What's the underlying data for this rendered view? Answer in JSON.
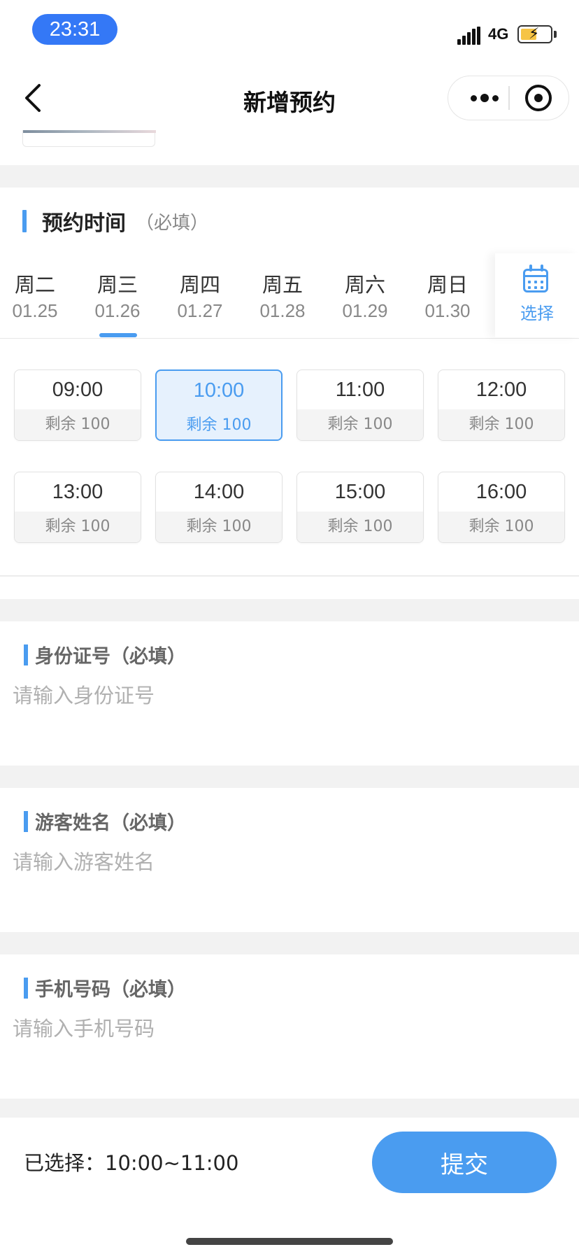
{
  "status_bar": {
    "time": "23:31",
    "network": "4G"
  },
  "nav": {
    "title": "新增预约"
  },
  "time_section": {
    "title": "预约时间",
    "required": "（必填）"
  },
  "days": [
    {
      "name": "周二",
      "date": "01.25"
    },
    {
      "name": "周三",
      "date": "01.26"
    },
    {
      "name": "周四",
      "date": "01.27"
    },
    {
      "name": "周五",
      "date": "01.28"
    },
    {
      "name": "周六",
      "date": "01.29"
    },
    {
      "name": "周日",
      "date": "01.30"
    }
  ],
  "selected_day_index": 1,
  "choose_label": "选择",
  "slots": [
    {
      "time": "09:00",
      "remaining": "剩余 100"
    },
    {
      "time": "10:00",
      "remaining": "剩余 100"
    },
    {
      "time": "11:00",
      "remaining": "剩余 100"
    },
    {
      "time": "12:00",
      "remaining": "剩余 100"
    },
    {
      "time": "13:00",
      "remaining": "剩余 100"
    },
    {
      "time": "14:00",
      "remaining": "剩余 100"
    },
    {
      "time": "15:00",
      "remaining": "剩余 100"
    },
    {
      "time": "16:00",
      "remaining": "剩余 100"
    }
  ],
  "selected_slot_index": 1,
  "fields": {
    "id_card": {
      "label": "身份证号（必填）",
      "placeholder": "请输入身份证号"
    },
    "name": {
      "label": "游客姓名（必填）",
      "placeholder": "请输入游客姓名"
    },
    "phone": {
      "label": "手机号码（必填）",
      "placeholder": "请输入手机号码"
    }
  },
  "bottom": {
    "selected_text": "已选择：10:00~11:00",
    "submit_label": "提交"
  },
  "colors": {
    "accent": "#4a9cf0",
    "time_pill": "#3478f6"
  }
}
